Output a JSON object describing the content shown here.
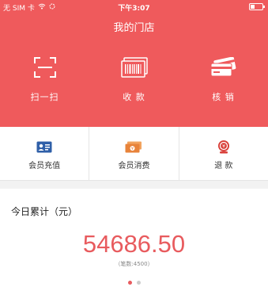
{
  "status_bar": {
    "carrier": "无 SIM 卡",
    "time": "下午3:07"
  },
  "header": {
    "title": "我的门店"
  },
  "top_actions": [
    {
      "label": "扫一扫",
      "icon": "scan-icon"
    },
    {
      "label": "收 款",
      "icon": "barcode-receive-icon"
    },
    {
      "label": "核 销",
      "icon": "cards-verify-icon"
    }
  ],
  "member_actions": [
    {
      "label": "会员充值",
      "icon": "member-card-icon",
      "color": "#2f5fa8"
    },
    {
      "label": "会员消费",
      "icon": "money-icon",
      "color": "#e8833a"
    },
    {
      "label": "退 款",
      "icon": "refund-icon",
      "color": "#d9403a"
    }
  ],
  "summary": {
    "title": "今日累计（元）",
    "amount": "54686.50",
    "count": "（笔数:4500）"
  },
  "pager": {
    "total": 2,
    "active_index": 0
  },
  "colors": {
    "brand": "#ef5a5c",
    "amount": "#e85b5e"
  }
}
